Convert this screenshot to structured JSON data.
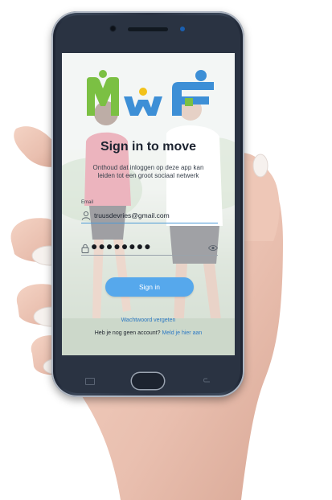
{
  "app": {
    "logo_text": "MWF",
    "title": "Sign in to move",
    "subtitle": "Onthoud dat inloggen op deze app kan leiden tot een groot sociaal netwerk"
  },
  "form": {
    "email_label": "Email",
    "email_value": "truusdevries@gmail.com",
    "password_mask": "●●●●●●●●",
    "signin_label": "Sign in"
  },
  "links": {
    "forgot_password": "Wachtwoord vergeten",
    "register_prompt": "Heb je nog geen account?",
    "register_link": "Meld je hier aan"
  },
  "colors": {
    "accent": "#56a8ec",
    "link": "#2f7ac4",
    "logo_green": "#7bc043",
    "logo_blue": "#3d8fd6",
    "logo_yellow": "#f2c21b"
  },
  "icons": {
    "email": "user-icon",
    "password": "lock-icon",
    "visibility": "eye-icon"
  }
}
